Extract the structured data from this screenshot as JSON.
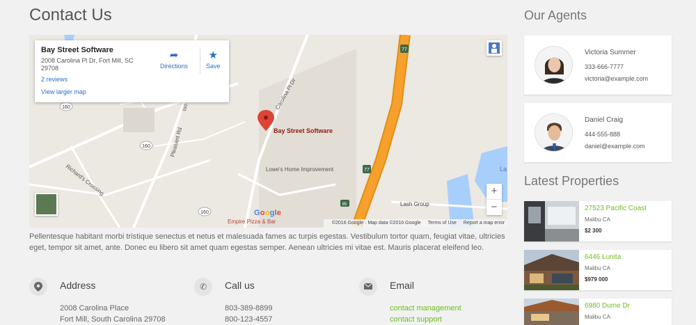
{
  "page_title": "Contact Us",
  "map": {
    "place_name": "Bay Street Software",
    "address": "2008 Carolina Pl Dr, Fort Mill, SC 29708",
    "reviews": "2 reviews",
    "view_larger": "View larger map",
    "directions_label": "Directions",
    "save_label": "Save",
    "marker_label": "Bay Street Software",
    "labels": {
      "carolina_pl": "Carolina Pl Dr",
      "pleasant_rd": "Pleasant Rd",
      "richards_crossing": "Richard's Crossing",
      "lowes": "Lowe's Home Improvement",
      "lash_group": "Lash Group",
      "empire_pizza": "Empire Pizza & Bar",
      "route_160": "160",
      "route_77": "77",
      "route_85": "85",
      "lake_fragment": "La",
      "iso_fragment": "Iso"
    },
    "google_logo": "Google",
    "footer": {
      "copyright": "©2016 Google · Map data ©2016 Google",
      "terms": "Terms of Use",
      "report": "Report a map error"
    },
    "zoom_in": "+",
    "zoom_out": "−"
  },
  "description": "Pellentesque habitant morbi tristique senectus et netus et malesuada fames ac turpis egestas. Vestibulum tortor quam, feugiat vitae, ultricies eget, tempor sit amet, ante. Donec eu libero sit amet quam egestas semper. Aenean ultricies mi vitae est. Mauris placerat eleifend leo.",
  "contact": {
    "address": {
      "title": "Address",
      "line1": "2008 Carolina Place",
      "line2": "Fort Mill, South Carolina 29708"
    },
    "call": {
      "title": "Call us",
      "line1": "803-389-8899",
      "line2": "800-123-4557"
    },
    "email": {
      "title": "Email",
      "line1": "contact management",
      "line2": "contact support"
    }
  },
  "agents_heading": "Our Agents",
  "agents": [
    {
      "name": "Victoria Summer",
      "phone": "333-666-7777",
      "email": "victoria@example.com"
    },
    {
      "name": "Daniel Craig",
      "phone": "444-555-888",
      "email": "daniel@example.com"
    }
  ],
  "properties_heading": "Latest Properties",
  "properties": [
    {
      "name": "27523 Pacific Coast",
      "location": "Malibu CA",
      "price": "$2 300"
    },
    {
      "name": "6446 Lunita",
      "location": "Malibu CA",
      "price": "$979 000"
    },
    {
      "name": "6980 Dume Dr",
      "location": "Malibu CA",
      "price": ""
    }
  ],
  "colors": {
    "accent_green": "#6bbf1e",
    "link_blue": "#2a6ec7",
    "marker_red": "#db4437",
    "highway_orange": "#f7a12c"
  }
}
